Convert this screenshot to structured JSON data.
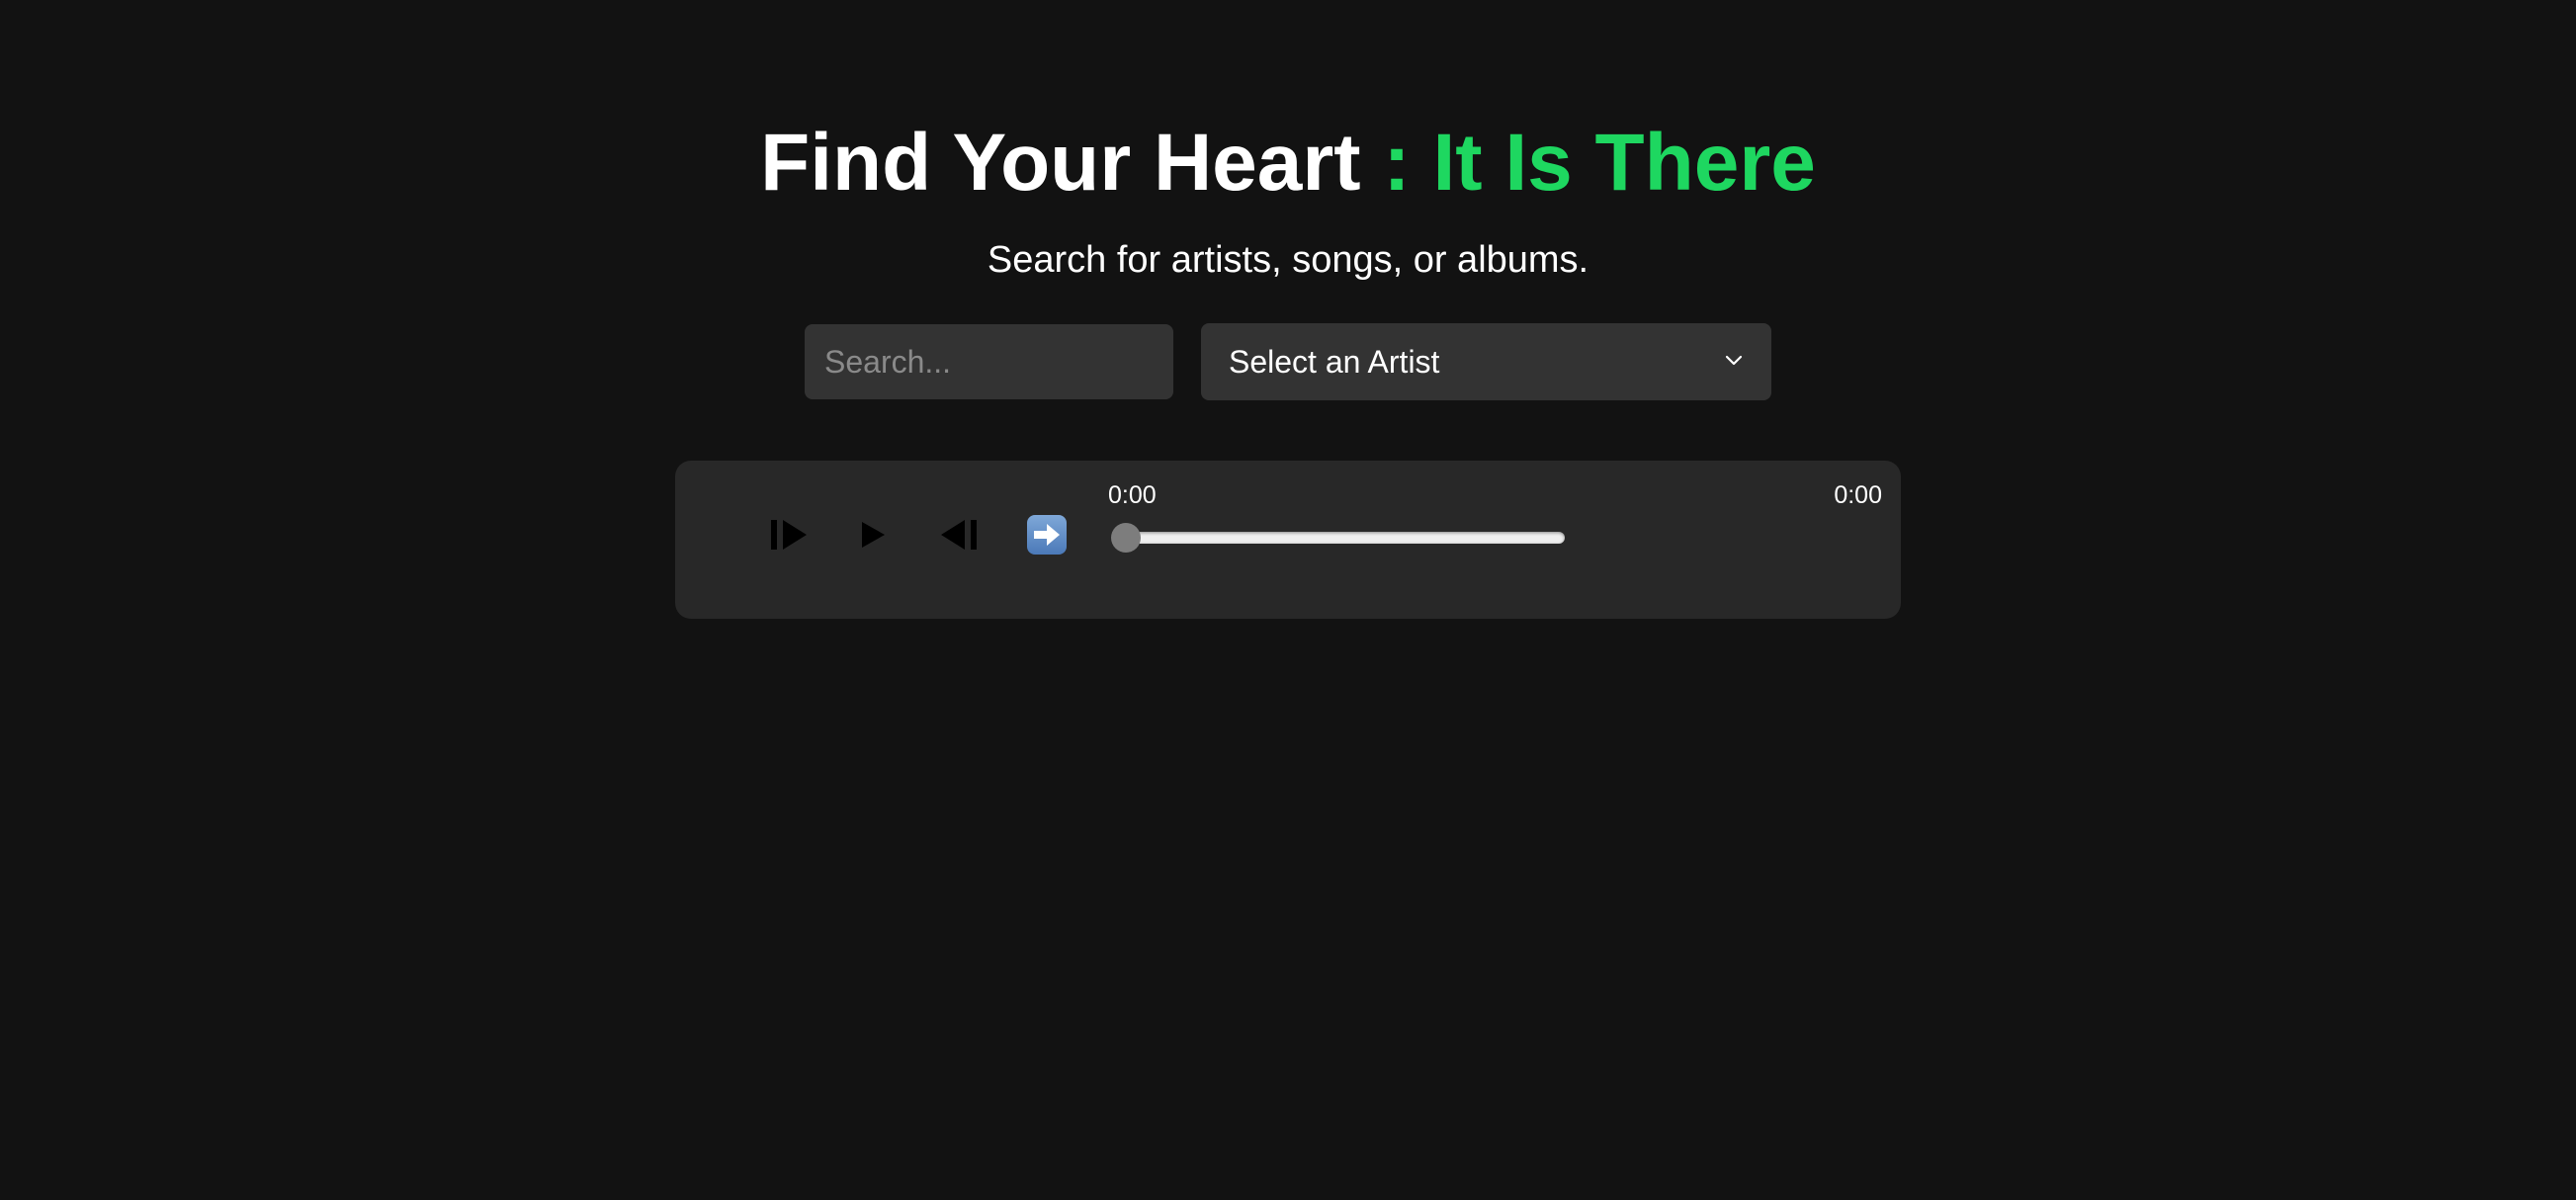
{
  "header": {
    "title_main": "Find Your Heart",
    "title_accent": " : It Is There",
    "subtitle": "Search for artists, songs, or albums."
  },
  "search": {
    "placeholder": "Search...",
    "value": ""
  },
  "artist_select": {
    "selected": "Select an Artist"
  },
  "player": {
    "current_time": "0:00",
    "duration": "0:00",
    "progress": 0,
    "controls": [
      {
        "name": "skip-forward-icon"
      },
      {
        "name": "play-icon"
      },
      {
        "name": "skip-back-icon"
      },
      {
        "name": "next-arrow-icon"
      }
    ]
  },
  "colors": {
    "background": "#121212",
    "accent": "#1ed760",
    "player_bg": "#282828",
    "input_bg": "#333333"
  }
}
